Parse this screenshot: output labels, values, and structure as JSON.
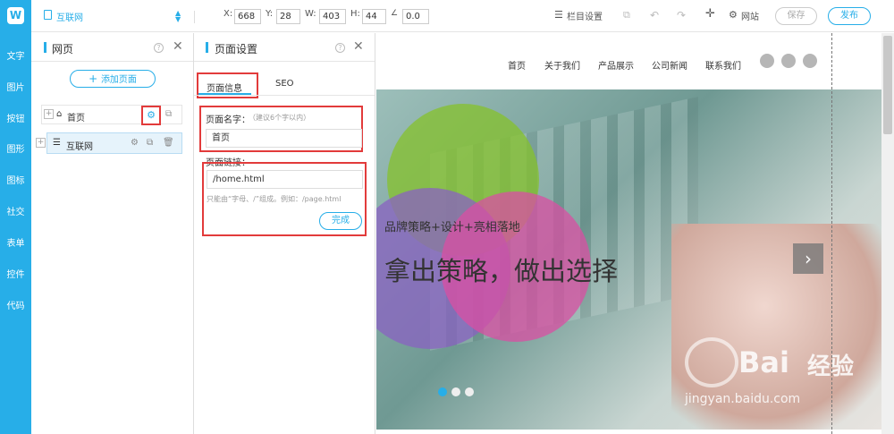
{
  "topbar": {
    "site_name": "互联网",
    "x_label": "X:",
    "x_value": "668",
    "y_label": "Y:",
    "y_value": "28",
    "w_label": "W:",
    "w_value": "403",
    "h_label": "H:",
    "h_value": "44",
    "angle_value": "0.0",
    "column_settings": "栏目设置",
    "site_label": "网站",
    "save_label": "保存",
    "publish_label": "发布"
  },
  "sidebar": {
    "items": [
      {
        "label": "文字"
      },
      {
        "label": "图片"
      },
      {
        "label": "按钮"
      },
      {
        "label": "图形"
      },
      {
        "label": "图标"
      },
      {
        "label": "社交"
      },
      {
        "label": "表单"
      },
      {
        "label": "控件"
      },
      {
        "label": "代码"
      }
    ]
  },
  "pages_panel": {
    "title": "网页",
    "add_page": "添加页面",
    "pages": [
      {
        "label": "首页"
      },
      {
        "label": "互联网"
      }
    ]
  },
  "settings_panel": {
    "title": "页面设置",
    "tabs": [
      {
        "label": "页面信息"
      },
      {
        "label": "SEO"
      }
    ],
    "name_label": "页面名字：",
    "name_hint": "（建议6个字以内）",
    "name_value": "首页",
    "link_label": "页面链接：",
    "link_value": "/home.html",
    "link_hint": "只能由“字母、/”组成。例如：/page.html",
    "done_label": "完成"
  },
  "preview": {
    "nav": [
      {
        "label": "首页"
      },
      {
        "label": "关于我们"
      },
      {
        "label": "产品展示"
      },
      {
        "label": "公司新闻"
      },
      {
        "label": "联系我们"
      }
    ],
    "hero_subtitle": "品牌策略+设计+亮相落地",
    "hero_title": "拿出策略，做出选择",
    "next_arrow": "›"
  },
  "watermark": {
    "brand": "Bai",
    "brand2": "经验",
    "url": "jingyan.baidu.com"
  },
  "colors": {
    "accent": "#27aee8",
    "annotation_red": "#e23b3b"
  }
}
